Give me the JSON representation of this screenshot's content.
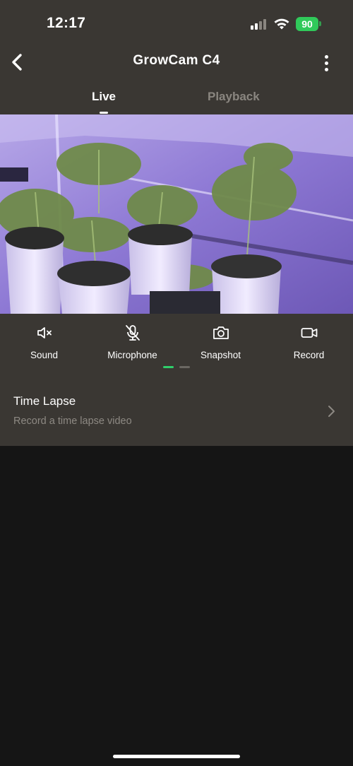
{
  "status_bar": {
    "time": "12:17",
    "battery": "90"
  },
  "header": {
    "title": "GrowCam C4",
    "back_icon": "chevron-left-icon",
    "more_icon": "more-vertical-icon"
  },
  "tabs": [
    {
      "label": "Live",
      "active": true
    },
    {
      "label": "Playback",
      "active": false
    }
  ],
  "controls": [
    {
      "label": "Sound",
      "icon": "speaker-muted-icon"
    },
    {
      "label": "Microphone",
      "icon": "microphone-off-icon"
    },
    {
      "label": "Snapshot",
      "icon": "camera-icon"
    },
    {
      "label": "Record",
      "icon": "video-camera-icon"
    }
  ],
  "page_indicator": {
    "pages": 2,
    "active": 1
  },
  "time_lapse": {
    "title": "Time Lapse",
    "subtitle": "Record a time lapse video"
  },
  "colors": {
    "header_bg": "#3a3733",
    "page_bg": "#151515",
    "accent": "#2fcf6b",
    "battery": "#30c95a"
  }
}
